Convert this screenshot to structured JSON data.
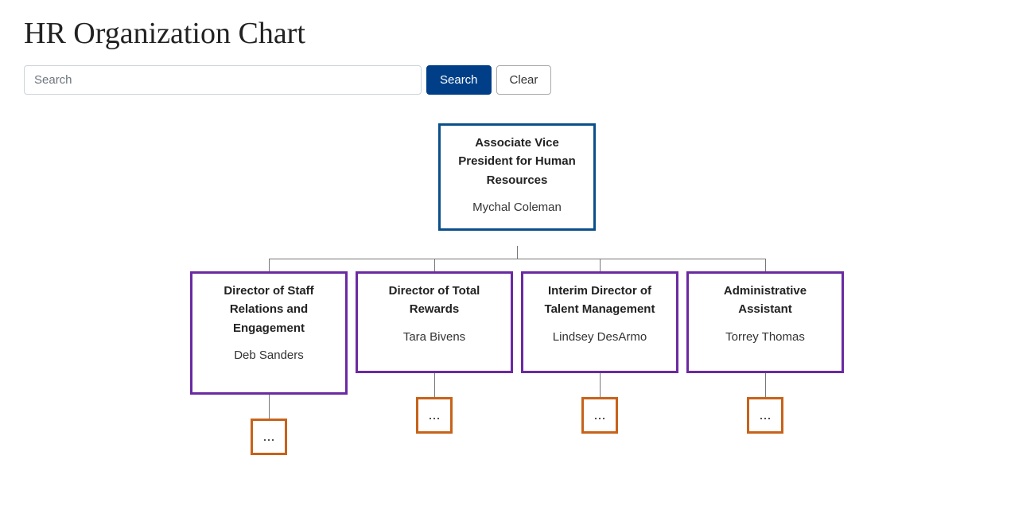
{
  "page": {
    "title": "HR Organization Chart"
  },
  "search": {
    "placeholder": "Search",
    "value": "",
    "search_label": "Search",
    "clear_label": "Clear"
  },
  "org": {
    "root": {
      "title": "Associate Vice President for Human Resources",
      "name": "Mychal Coleman"
    },
    "children": [
      {
        "title": "Director of Staff Relations and Engagement",
        "name": "Deb Sanders",
        "expand_label": "..."
      },
      {
        "title": "Director of Total Rewards",
        "name": "Tara Bivens",
        "expand_label": "..."
      },
      {
        "title": "Interim Director of Talent Management",
        "name": "Lindsey DesArmo",
        "expand_label": "..."
      },
      {
        "title": "Administrative Assistant",
        "name": "Torrey Thomas",
        "expand_label": "..."
      }
    ]
  },
  "layout": {
    "childLefts": [
      50,
      258,
      466,
      674
    ],
    "childHeights": [
      155,
      128,
      128,
      128
    ],
    "topNodeCenterX": 461,
    "topNodeBottomY": 154,
    "horizRailY": 170,
    "childTopY": 186,
    "expandSize": 46
  },
  "colors": {
    "primary_button": "#003f87",
    "root_border": "#0b4f8a",
    "child_border": "#6a2aa2",
    "expand_border": "#c7621a"
  }
}
